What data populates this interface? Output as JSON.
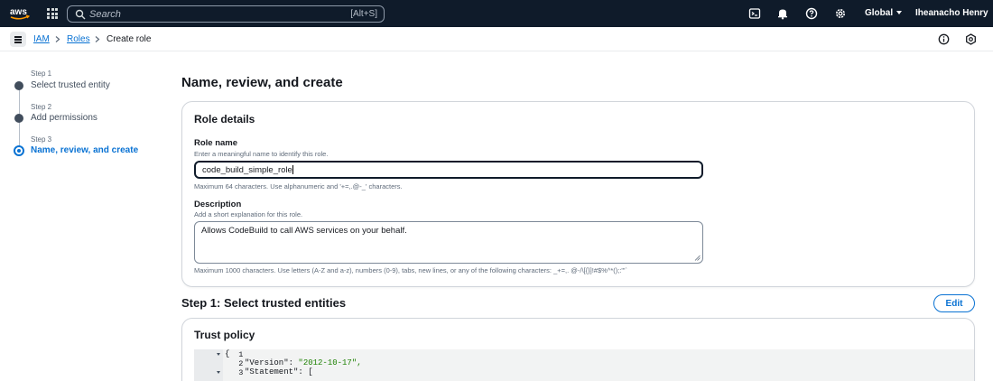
{
  "topnav": {
    "logo": "aws",
    "search_placeholder": "Search",
    "search_shortcut": "[Alt+S]",
    "icons": [
      "cloudshell-icon",
      "bell-icon",
      "help-icon",
      "gear-icon"
    ],
    "region": "Global",
    "user": "Iheanacho Henry"
  },
  "breadcrumb": {
    "items": [
      "IAM",
      "Roles"
    ],
    "current": "Create role"
  },
  "steps": [
    {
      "num": "Step 1",
      "title": "Select trusted entity",
      "active": false
    },
    {
      "num": "Step 2",
      "title": "Add permissions",
      "active": false
    },
    {
      "num": "Step 3",
      "title": "Name, review, and create",
      "active": true
    }
  ],
  "main": {
    "page_title": "Name, review, and create",
    "role_details": {
      "title": "Role details",
      "role_name_label": "Role name",
      "role_name_desc": "Enter a meaningful name to identify this role.",
      "role_name_value": "code_build_simple_role",
      "role_name_hint": "Maximum 64 characters. Use alphanumeric and '+=,.@-_' characters.",
      "description_label": "Description",
      "description_desc": "Add a short explanation for this role.",
      "description_value": "Allows CodeBuild to call AWS services on your behalf.",
      "description_hint": "Maximum 1000 characters. Use letters (A-Z and a-z), numbers (0-9), tabs, new lines, or any of the following characters: _+=,. @-/\\[{}]!#$%^*();:\"'`"
    },
    "step1": {
      "title": "Step 1: Select trusted entities",
      "edit_label": "Edit",
      "trust_policy_title": "Trust policy",
      "code_lines": [
        {
          "num": "1",
          "fold": true,
          "text": "{"
        },
        {
          "num": "2",
          "fold": false,
          "key": "\"Version\"",
          "value": "\"2012-10-17\","
        },
        {
          "num": "3",
          "fold": true,
          "key": "\"Statement\"",
          "value": "["
        }
      ]
    }
  },
  "colors": {
    "nav_bg": "#0f1b2a",
    "link": "#0972d3",
    "string": "#1d8102"
  }
}
